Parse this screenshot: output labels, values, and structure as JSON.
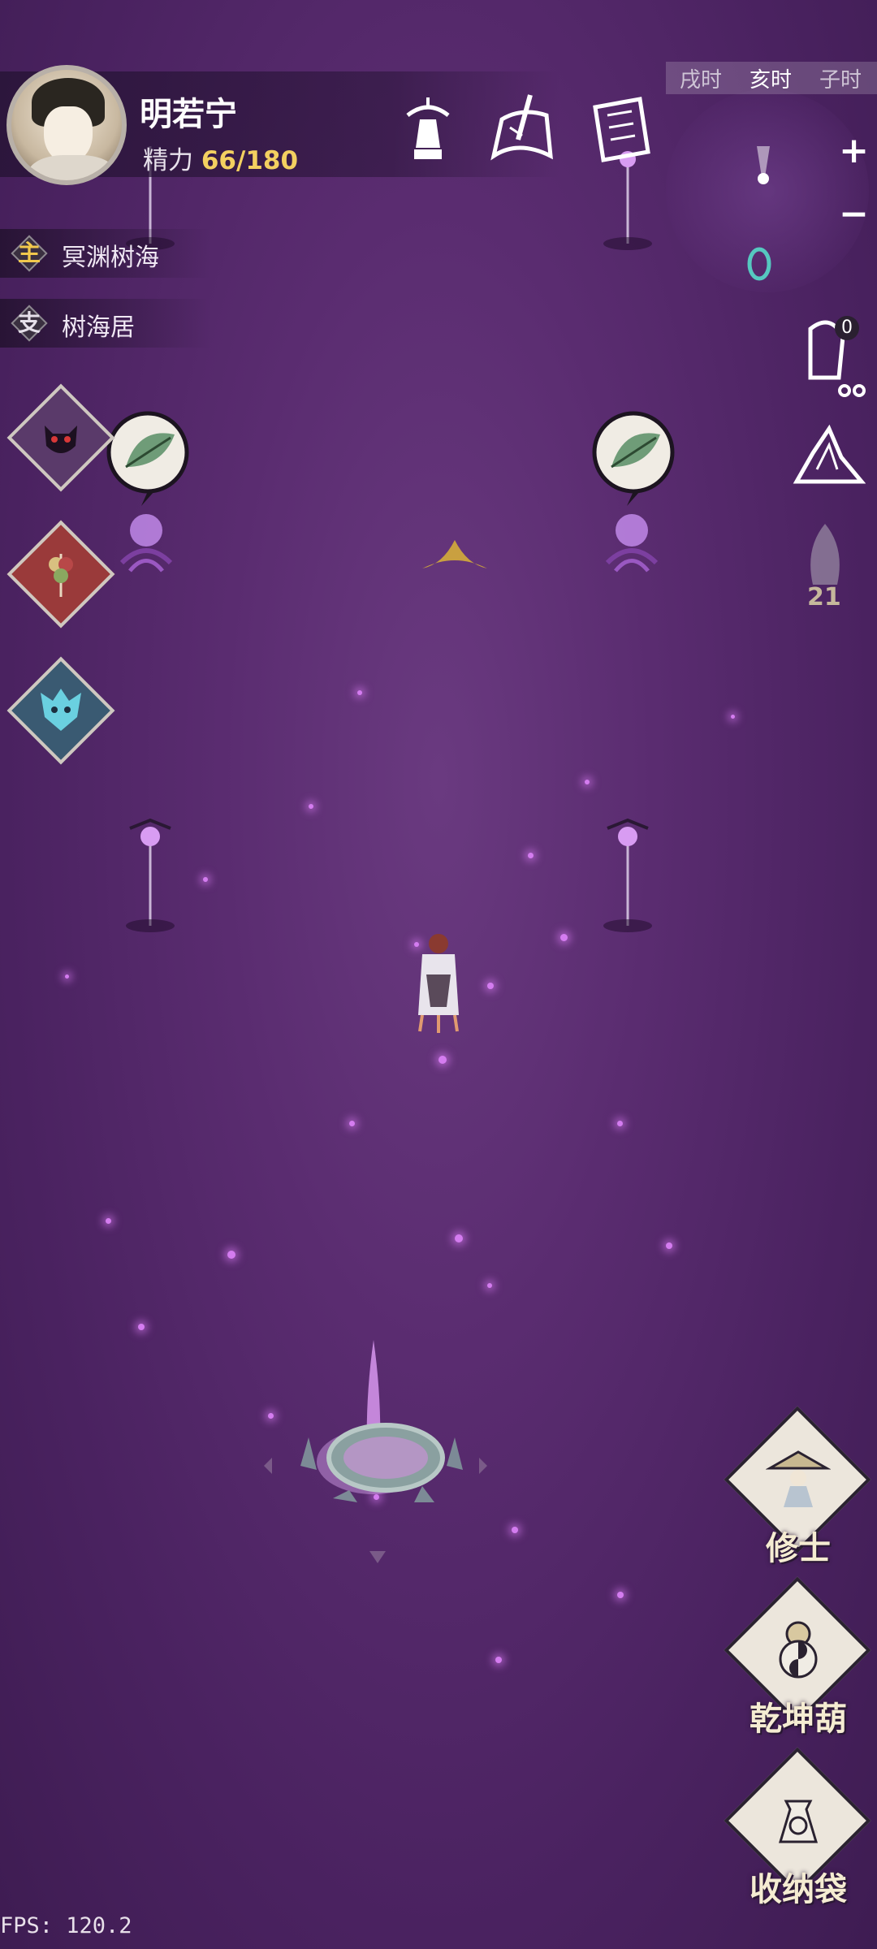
{
  "player": {
    "name": "明若宁",
    "stamina_label": "精力",
    "stamina_value": "66/180"
  },
  "top_icons": [
    "pagoda-icon",
    "brush-scroll-icon",
    "ledger-icon"
  ],
  "time_bar": {
    "prev": "戌时",
    "current": "亥时",
    "next": "子时"
  },
  "minimap": {
    "zoom_in": "+",
    "zoom_out": "−"
  },
  "quests": [
    {
      "tag": "主",
      "tag_color": "#f1c94c",
      "text": "冥渊树海"
    },
    {
      "tag": "支",
      "tag_color": "#e6e0ea",
      "text": "树海居"
    }
  ],
  "skills": [
    "demon-mask-icon",
    "skewer-icon",
    "azure-dragon-icon"
  ],
  "side_icons": {
    "bell_badge": "0",
    "counter": "21"
  },
  "buttons": [
    {
      "label": "修士",
      "icon": "cultivator-icon"
    },
    {
      "label": "乾坤葫",
      "icon": "gourd-icon"
    },
    {
      "label": "收纳袋",
      "icon": "storage-bag-icon"
    }
  ],
  "fps": "FPS: 120.2",
  "colors": {
    "background": "#5a2c70",
    "stamina_value": "#f3d060",
    "sparkle": "#d47cf0"
  }
}
